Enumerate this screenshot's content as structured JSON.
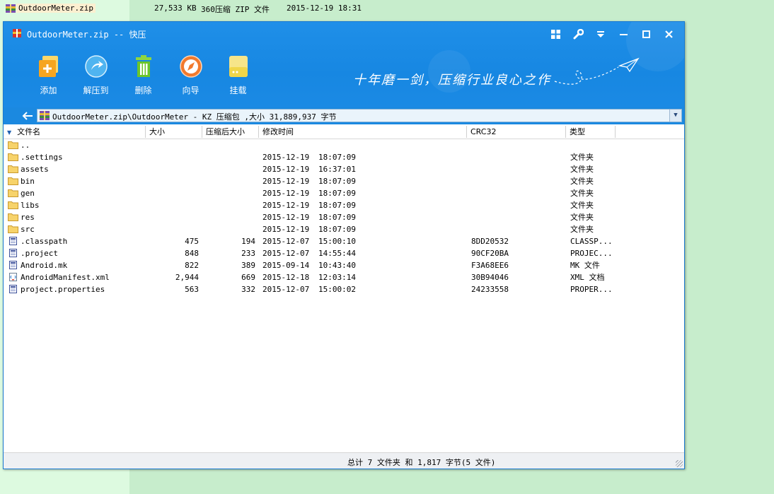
{
  "background": {
    "file_name": "OutdoorMeter.zip",
    "size": "27,533 KB",
    "type": "360压缩 ZIP 文件",
    "modified": "2015-12-19 18:31"
  },
  "window": {
    "title": "OutdoorMeter.zip -- 快压",
    "controls": [
      {
        "name": "grid-icon",
        "glyph": "▦"
      },
      {
        "name": "wrench-icon",
        "glyph": "🔧"
      },
      {
        "name": "menu-down-icon",
        "glyph": "⩡"
      },
      {
        "name": "minimize-icon",
        "glyph": "–"
      },
      {
        "name": "maximize-icon",
        "glyph": "□"
      },
      {
        "name": "close-icon",
        "glyph": "✕"
      }
    ]
  },
  "toolbar": {
    "add_label": "添加",
    "extract_label": "解压到",
    "delete_label": "删除",
    "wizard_label": "向导",
    "mount_label": "挂载"
  },
  "slogan": "十年磨一剑，压缩行业良心之作",
  "path": {
    "text": "OutdoorMeter.zip\\OutdoorMeter - KZ 压缩包 ,大小 31,889,937 字节"
  },
  "columns": {
    "name": "文件名",
    "size": "大小",
    "compressed": "压缩后大小",
    "modified": "修改时间",
    "crc": "CRC32",
    "type": "类型"
  },
  "files": [
    {
      "kind": "folder",
      "name": "..",
      "size": "",
      "compressed": "",
      "date": "",
      "time": "",
      "crc": "",
      "type": ""
    },
    {
      "kind": "folder",
      "name": ".settings",
      "size": "",
      "compressed": "",
      "date": "2015-12-19",
      "time": "18:07:09",
      "crc": "",
      "type": "文件夹"
    },
    {
      "kind": "folder",
      "name": "assets",
      "size": "",
      "compressed": "",
      "date": "2015-12-19",
      "time": "16:37:01",
      "crc": "",
      "type": "文件夹"
    },
    {
      "kind": "folder",
      "name": "bin",
      "size": "",
      "compressed": "",
      "date": "2015-12-19",
      "time": "18:07:09",
      "crc": "",
      "type": "文件夹"
    },
    {
      "kind": "folder",
      "name": "gen",
      "size": "",
      "compressed": "",
      "date": "2015-12-19",
      "time": "18:07:09",
      "crc": "",
      "type": "文件夹"
    },
    {
      "kind": "folder",
      "name": "libs",
      "size": "",
      "compressed": "",
      "date": "2015-12-19",
      "time": "18:07:09",
      "crc": "",
      "type": "文件夹"
    },
    {
      "kind": "folder",
      "name": "res",
      "size": "",
      "compressed": "",
      "date": "2015-12-19",
      "time": "18:07:09",
      "crc": "",
      "type": "文件夹"
    },
    {
      "kind": "folder",
      "name": "src",
      "size": "",
      "compressed": "",
      "date": "2015-12-19",
      "time": "18:07:09",
      "crc": "",
      "type": "文件夹"
    },
    {
      "kind": "file",
      "name": ".classpath",
      "size": "475",
      "compressed": "194",
      "date": "2015-12-07",
      "time": "15:00:10",
      "crc": "8DD20532",
      "type": "CLASSP..."
    },
    {
      "kind": "file",
      "name": ".project",
      "size": "848",
      "compressed": "233",
      "date": "2015-12-07",
      "time": "14:55:44",
      "crc": "90CF20BA",
      "type": "PROJEC..."
    },
    {
      "kind": "file",
      "name": "Android.mk",
      "size": "822",
      "compressed": "389",
      "date": "2015-09-14",
      "time": "10:43:40",
      "crc": "F3A68EE6",
      "type": "MK 文件"
    },
    {
      "kind": "xml",
      "name": "AndroidManifest.xml",
      "size": "2,944",
      "compressed": "669",
      "date": "2015-12-18",
      "time": "12:03:14",
      "crc": "30B94046",
      "type": "XML 文档"
    },
    {
      "kind": "file",
      "name": "project.properties",
      "size": "563",
      "compressed": "332",
      "date": "2015-12-07",
      "time": "15:00:02",
      "crc": "24233558",
      "type": "PROPER..."
    }
  ],
  "status": "总计 7 文件夹  和  1,817 字节(5 文件)"
}
